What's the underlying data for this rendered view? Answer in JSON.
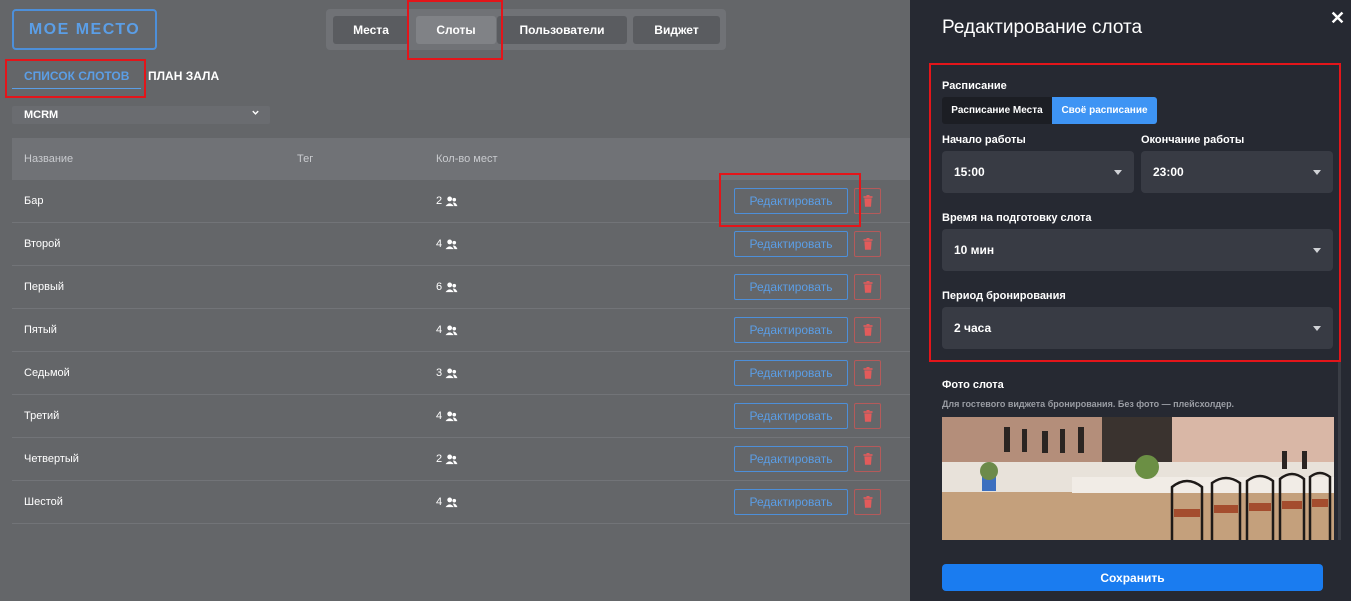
{
  "brand": {
    "logo_text": "МОЕ МЕСТО"
  },
  "topnav": {
    "tabs": [
      "Места",
      "Слоты",
      "Пользователи",
      "Виджет"
    ],
    "active": "Слоты"
  },
  "subtabs": {
    "list": "СПИСОК СЛОТОВ",
    "hall_plan": "ПЛАН ЗАЛА"
  },
  "venue_select": {
    "value": "MCRM"
  },
  "table": {
    "headers": {
      "name": "Название",
      "tag": "Тег",
      "seats": "Кол-во мест"
    },
    "rows": [
      {
        "name": "Бар",
        "seats": "2"
      },
      {
        "name": "Второй",
        "seats": "4"
      },
      {
        "name": "Первый",
        "seats": "6"
      },
      {
        "name": "Пятый",
        "seats": "4"
      },
      {
        "name": "Седьмой",
        "seats": "3"
      },
      {
        "name": "Третий",
        "seats": "4"
      },
      {
        "name": "Четвертый",
        "seats": "2"
      },
      {
        "name": "Шестой",
        "seats": "4"
      }
    ],
    "edit_label": "Редактировать"
  },
  "panel": {
    "title": "Редактирование слота",
    "close": "✕",
    "schedule_label": "Расписание",
    "schedule_options": {
      "venue": "Расписание Места",
      "own": "Своё расписание"
    },
    "start_label": "Начало работы",
    "start_value": "15:00",
    "end_label": "Окончание работы",
    "end_value": "23:00",
    "prep_label": "Время на подготовку слота",
    "prep_value": "10 мин",
    "period_label": "Период бронирования",
    "period_value": "2 часа",
    "photo_label": "Фото слота",
    "photo_hint": "Для гостевого виджета бронирования. Без фото — плейсхолдер.",
    "save_label": "Сохранить"
  },
  "colors": {
    "accent": "#3e94f4",
    "highlight": "#e3151a",
    "panel_bg": "#262932",
    "page_bg": "#646669"
  }
}
